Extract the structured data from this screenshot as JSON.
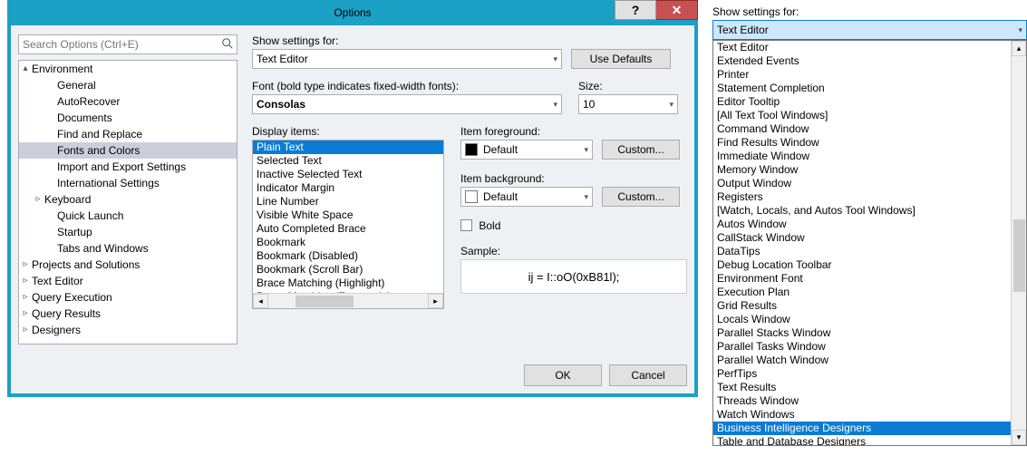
{
  "dialog": {
    "title": "Options",
    "help_glyph": "?",
    "close_glyph": "✕",
    "search_placeholder": "Search Options (Ctrl+E)",
    "ok": "OK",
    "cancel": "Cancel"
  },
  "tree": [
    {
      "label": "Environment",
      "depth": 0,
      "expander": "▴"
    },
    {
      "label": "General",
      "depth": 1,
      "leaf": true
    },
    {
      "label": "AutoRecover",
      "depth": 1,
      "leaf": true
    },
    {
      "label": "Documents",
      "depth": 1,
      "leaf": true
    },
    {
      "label": "Find and Replace",
      "depth": 1,
      "leaf": true
    },
    {
      "label": "Fonts and Colors",
      "depth": 1,
      "leaf": true,
      "selected": true
    },
    {
      "label": "Import and Export Settings",
      "depth": 1,
      "leaf": true
    },
    {
      "label": "International Settings",
      "depth": 1,
      "leaf": true
    },
    {
      "label": "Keyboard",
      "depth": 1,
      "expander": "▹"
    },
    {
      "label": "Quick Launch",
      "depth": 1,
      "leaf": true
    },
    {
      "label": "Startup",
      "depth": 1,
      "leaf": true
    },
    {
      "label": "Tabs and Windows",
      "depth": 1,
      "leaf": true
    },
    {
      "label": "Projects and Solutions",
      "depth": 0,
      "expander": "▹"
    },
    {
      "label": "Text Editor",
      "depth": 0,
      "expander": "▹"
    },
    {
      "label": "Query Execution",
      "depth": 0,
      "expander": "▹"
    },
    {
      "label": "Query Results",
      "depth": 0,
      "expander": "▹"
    },
    {
      "label": "Designers",
      "depth": 0,
      "expander": "▹"
    }
  ],
  "fonts_page": {
    "show_settings_label": "Show settings for:",
    "show_settings_value": "Text Editor",
    "use_defaults": "Use Defaults",
    "font_label": "Font (bold type indicates fixed-width fonts):",
    "font_value": "Consolas",
    "size_label": "Size:",
    "size_value": "10",
    "display_items_label": "Display items:",
    "display_items": [
      "Plain Text",
      "Selected Text",
      "Inactive Selected Text",
      "Indicator Margin",
      "Line Number",
      "Visible White Space",
      "Auto Completed Brace",
      "Bookmark",
      "Bookmark (Disabled)",
      "Bookmark (Scroll Bar)",
      "Brace Matching (Highlight)",
      "Brace Matching (Rectangle)"
    ],
    "display_items_selected": "Plain Text",
    "item_fg_label": "Item foreground:",
    "item_fg_value": "Default",
    "item_fg_swatch": "#000000",
    "item_bg_label": "Item background:",
    "item_bg_value": "Default",
    "item_bg_swatch": "#ffffff",
    "custom": "Custom...",
    "bold_label": "Bold",
    "bold_checked": false,
    "sample_label": "Sample:",
    "sample_text": "ij = I::oO(0xB81l);"
  },
  "side": {
    "label": "Show settings for:",
    "selected_value": "Text Editor",
    "highlighted": "Business Intelligence Designers",
    "options": [
      "Text Editor",
      "Extended Events",
      "Printer",
      "Statement Completion",
      "Editor Tooltip",
      "[All Text Tool Windows]",
      "Command Window",
      "Find Results Window",
      "Immediate Window",
      "Memory Window",
      "Output Window",
      "Registers",
      "[Watch, Locals, and Autos Tool Windows]",
      "Autos Window",
      "CallStack Window",
      "DataTips",
      "Debug Location Toolbar",
      "Environment Font",
      "Execution Plan",
      "Grid Results",
      "Locals Window",
      "Parallel Stacks Window",
      "Parallel Tasks Window",
      "Parallel Watch Window",
      "PerfTips",
      "Text Results",
      "Threads Window",
      "Watch Windows",
      "Business Intelligence Designers",
      "Table and Database Designers"
    ]
  }
}
